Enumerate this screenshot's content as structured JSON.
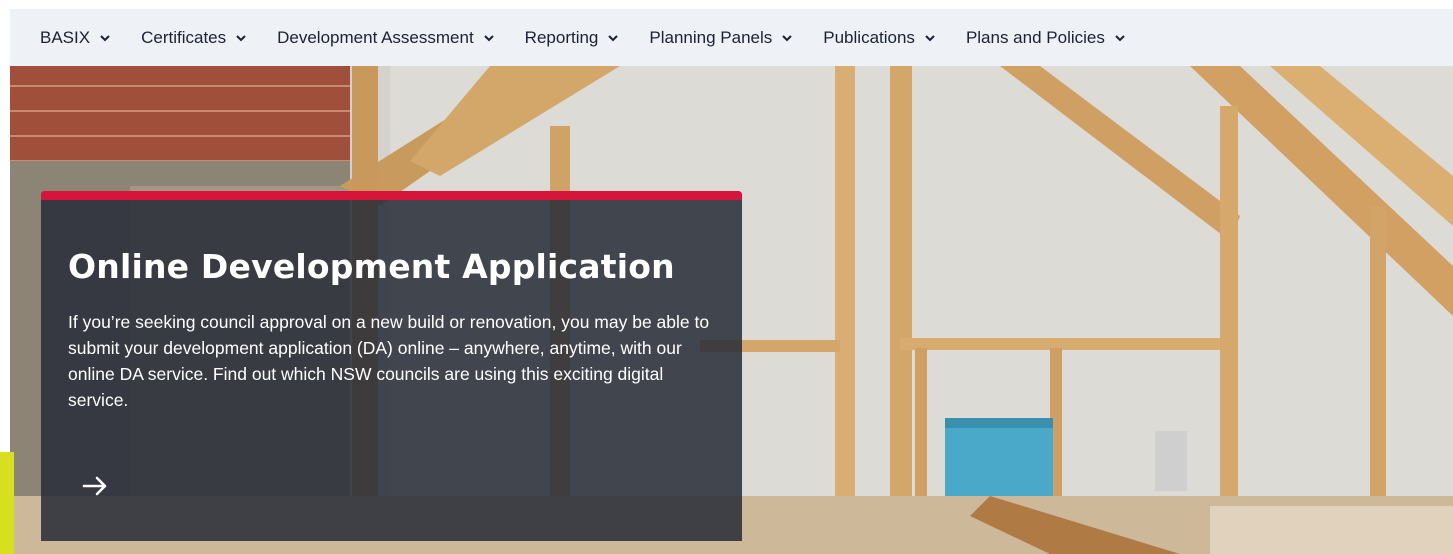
{
  "nav": {
    "items": [
      {
        "label": "BASIX"
      },
      {
        "label": "Certificates"
      },
      {
        "label": "Development Assessment"
      },
      {
        "label": "Reporting"
      },
      {
        "label": "Planning Panels"
      },
      {
        "label": "Publications"
      },
      {
        "label": "Plans and Policies"
      }
    ]
  },
  "hero": {
    "title": "Online Development Application",
    "description": "If you’re seeking council approval on a new build or renovation, you may be able to submit your development application (DA) online – anywhere, anytime, with our online DA service. Find out which NSW councils are using this exciting digital service.",
    "arrow_icon": "arrow-right-icon"
  },
  "colors": {
    "nav_bg": "#eef1f6",
    "accent_red": "#d7153a",
    "accent_yellow": "#d6e021",
    "card_bg": "#282c38"
  }
}
